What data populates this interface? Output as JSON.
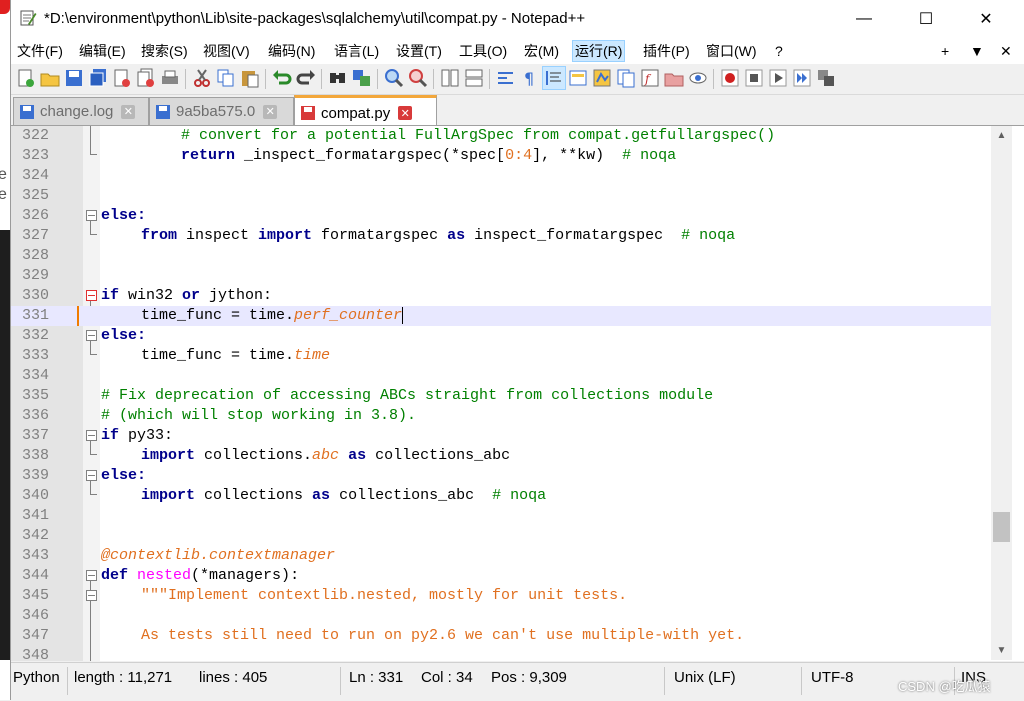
{
  "window": {
    "title": "*D:\\environment\\python\\Lib\\site-packages\\sqlalchemy\\util\\compat.py - Notepad++",
    "minimize": "—",
    "maximize": "☐",
    "close": "✕"
  },
  "menu": [
    "文件(F)",
    "编辑(E)",
    "搜索(S)",
    "视图(V)",
    "编码(N)",
    "语言(L)",
    "设置(T)",
    "工具(O)",
    "宏(M)",
    "运行(R)",
    "插件(P)",
    "窗口(W)",
    "?"
  ],
  "menu_right": {
    "plus": "+",
    "down": "▼",
    "close": "✕"
  },
  "tabs": [
    {
      "label": "change.log",
      "active": false
    },
    {
      "label": "9a5ba575.0",
      "active": false
    },
    {
      "label": "compat.py",
      "active": true
    }
  ],
  "editor": {
    "lines": [
      {
        "n": "322"
      },
      {
        "n": "323"
      },
      {
        "n": "324"
      },
      {
        "n": "325"
      },
      {
        "n": "326"
      },
      {
        "n": "327"
      },
      {
        "n": "328"
      },
      {
        "n": "329"
      },
      {
        "n": "330"
      },
      {
        "n": "331"
      },
      {
        "n": "332"
      },
      {
        "n": "333"
      },
      {
        "n": "334"
      },
      {
        "n": "335"
      },
      {
        "n": "336"
      },
      {
        "n": "337"
      },
      {
        "n": "338"
      },
      {
        "n": "339"
      },
      {
        "n": "340"
      },
      {
        "n": "341"
      },
      {
        "n": "342"
      },
      {
        "n": "343"
      },
      {
        "n": "344"
      },
      {
        "n": "345"
      },
      {
        "n": "346"
      },
      {
        "n": "347"
      },
      {
        "n": "348"
      }
    ],
    "code": {
      "l322": "# convert for a potential FullArgSpec from compat.getfullargspec()",
      "l323a": "return",
      "l323b": " _inspect_formatargspec(*spec[",
      "l323c": "0:4",
      "l323d": "], **kw)  ",
      "l323e": "# noqa",
      "l326": "else:",
      "l327a": "from",
      "l327b": " inspect ",
      "l327c": "import",
      "l327d": " formatargspec ",
      "l327e": "as",
      "l327f": " inspect_formatargspec  ",
      "l327g": "# noqa",
      "l330a": "if",
      "l330b": " win32 ",
      "l330c": "or",
      "l330d": " jython:",
      "l331a": "time_func = time.",
      "l331b": "perf_counter",
      "l332": "else:",
      "l333a": "time_func = time.",
      "l333b": "time",
      "l335": "# Fix deprecation of accessing ABCs straight from collections module",
      "l336": "# (which will stop working in 3.8).",
      "l337a": "if",
      "l337b": " py33:",
      "l338a": "import",
      "l338b": " collections.",
      "l338c": "abc",
      "l338d": " ",
      "l338e": "as",
      "l338f": " collections_abc",
      "l339": "else:",
      "l340a": "import",
      "l340b": " collections ",
      "l340c": "as",
      "l340d": " collections_abc  ",
      "l340e": "# noqa",
      "l343a": "@contextlib",
      "l343b": ".contextmanager",
      "l344a": "def",
      "l344b": " ",
      "l344c": "nested",
      "l344d": "(*managers):",
      "l345": "\"\"\"Implement contextlib.nested, mostly for unit tests.",
      "l347": "As tests still need to run on py2.6 we can't use multiple-with yet."
    }
  },
  "status": {
    "lang": "Python",
    "length": "length : 11,271",
    "lines": "lines : 405",
    "ln": "Ln : 331",
    "col": "Col : 34",
    "pos": "Pos : 9,309",
    "eol": "Unix (LF)",
    "enc": "UTF-8",
    "ins": "INS"
  },
  "watermark": "CSDN @吃瓜猿",
  "behind_fragments": [
    "e",
    "e"
  ],
  "colors": {
    "keyword": "#00008b",
    "comment": "#008000",
    "string": "#e07020",
    "active_tab": "#f3a73b",
    "current_line": "#e8e8ff"
  }
}
